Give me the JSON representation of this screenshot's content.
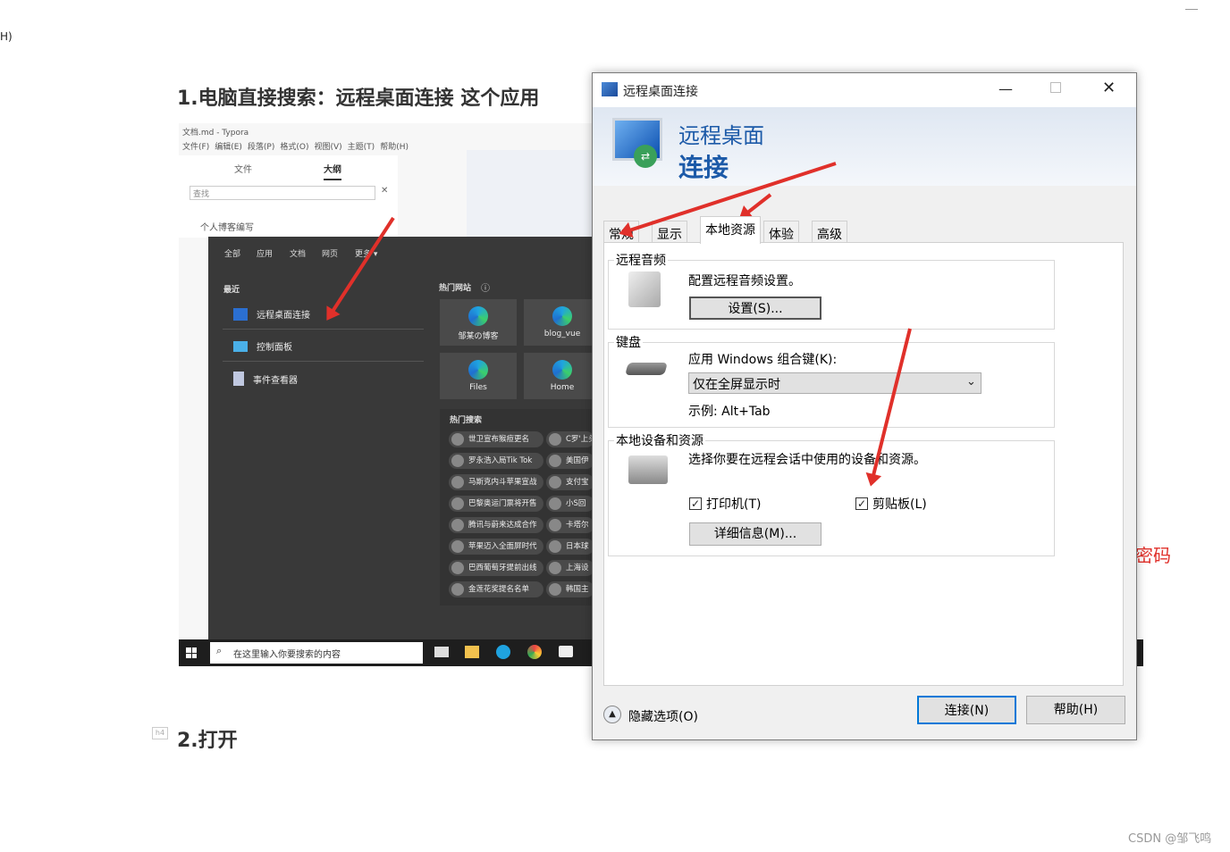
{
  "page": {
    "corner_text": "H)",
    "heading1": "1.电脑直接搜索：远程桌面连接  这个应用",
    "heading2": "2.打开",
    "h4_tag": "h4",
    "side_text": "密码",
    "watermark": "CSDN @邹飞鸣"
  },
  "embedded": {
    "typora_title": "文档.md - Typora",
    "menu": [
      "文件(F)",
      "编辑(E)",
      "段落(P)",
      "格式(O)",
      "视图(V)",
      "主题(T)",
      "帮助(H)"
    ],
    "side_tabs": [
      "文件",
      "大纲"
    ],
    "search_placeholder": "查找",
    "outline_first": "个人博客编写",
    "start_tabs": [
      "全部",
      "应用",
      "文档",
      "网页",
      "更多 ▾"
    ],
    "recent_label": "最近",
    "recent_items": [
      "远程桌面连接",
      "控制面板",
      "事件查看器"
    ],
    "hot_sites_label": "热门网站",
    "tiles": [
      "邹某の博客",
      "blog_vue",
      "Files",
      "Home"
    ],
    "hot_search_label": "热门搜索",
    "hot_left": [
      "世卫宣布猴痘更名",
      "罗永浩入局Tik Tok",
      "马斯克内斗苹果宣战",
      "巴黎奥运门票将开售",
      "腾讯与蔚来达成合作",
      "苹果迈入全面屏时代",
      "巴西葡萄牙提前出线",
      "金莲花奖提名名单"
    ],
    "hot_right": [
      "C罗'上头",
      "美国伊",
      "支付宝",
      "小S回",
      "卡塔尔",
      "日本球",
      "上海设",
      "韩国主"
    ],
    "taskbar_search": "在这里输入你要搜索的内容"
  },
  "dialog": {
    "title": "远程桌面连接",
    "banner_line1": "远程桌面",
    "banner_line2": "连接",
    "tabs": [
      "常规",
      "显示",
      "本地资源",
      "体验",
      "高级"
    ],
    "audio": {
      "label": "远程音频",
      "desc": "配置远程音频设置。",
      "button": "设置(S)..."
    },
    "keyboard": {
      "label": "键盘",
      "desc": "应用 Windows 组合键(K):",
      "select": "仅在全屏显示时",
      "example": "示例: Alt+Tab"
    },
    "devices": {
      "label": "本地设备和资源",
      "desc": "选择你要在远程会话中使用的设备和资源。",
      "printer": "打印机(T)",
      "clipboard": "剪贴板(L)",
      "more": "详细信息(M)..."
    },
    "hide_options": "隐藏选项(O)",
    "connect": "连接(N)",
    "help": "帮助(H)"
  },
  "colors": {
    "annotation_arrow": "#e0302a",
    "banner_text": "#1c5aa8",
    "dark_menu": "#393939"
  }
}
